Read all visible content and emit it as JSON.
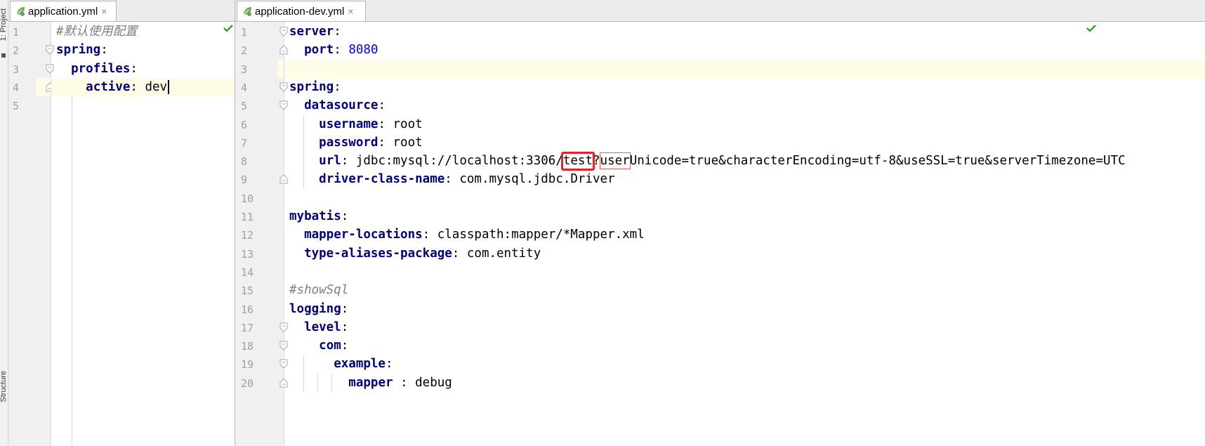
{
  "tool_window": {
    "project_label": "1: Project",
    "structure_label": "Structure"
  },
  "left_editor": {
    "tab": {
      "name": "application.yml",
      "close": "×"
    },
    "lines": [
      {
        "n": "1",
        "parts": [
          {
            "t": "#默认使用配置",
            "c": "c"
          }
        ]
      },
      {
        "n": "2",
        "parts": [
          {
            "t": "spring",
            "c": "k"
          },
          {
            "t": ":",
            "c": "p"
          }
        ]
      },
      {
        "n": "3",
        "parts": [
          {
            "t": "  ",
            "c": "p"
          },
          {
            "t": "profiles",
            "c": "k"
          },
          {
            "t": ":",
            "c": "p"
          }
        ]
      },
      {
        "n": "4",
        "parts": [
          {
            "t": "    ",
            "c": "p"
          },
          {
            "t": "active",
            "c": "k"
          },
          {
            "t": ": dev",
            "c": "p"
          }
        ]
      },
      {
        "n": "5",
        "parts": []
      }
    ]
  },
  "right_editor": {
    "tab": {
      "name": "application-dev.yml",
      "close": "×"
    },
    "lines": [
      {
        "n": "1",
        "parts": [
          {
            "t": "server",
            "c": "k"
          },
          {
            "t": ":",
            "c": "p"
          }
        ]
      },
      {
        "n": "2",
        "parts": [
          {
            "t": "  ",
            "c": "p"
          },
          {
            "t": "port",
            "c": "k"
          },
          {
            "t": ": ",
            "c": "p"
          },
          {
            "t": "8080",
            "c": "n"
          }
        ]
      },
      {
        "n": "3",
        "parts": []
      },
      {
        "n": "4",
        "parts": [
          {
            "t": "spring",
            "c": "k"
          },
          {
            "t": ":",
            "c": "p"
          }
        ]
      },
      {
        "n": "5",
        "parts": [
          {
            "t": "  ",
            "c": "p"
          },
          {
            "t": "datasource",
            "c": "k"
          },
          {
            "t": ":",
            "c": "p"
          }
        ]
      },
      {
        "n": "6",
        "parts": [
          {
            "t": "    ",
            "c": "p"
          },
          {
            "t": "username",
            "c": "k"
          },
          {
            "t": ": root",
            "c": "p"
          }
        ]
      },
      {
        "n": "7",
        "parts": [
          {
            "t": "    ",
            "c": "p"
          },
          {
            "t": "password",
            "c": "k"
          },
          {
            "t": ": root",
            "c": "p"
          }
        ]
      },
      {
        "n": "8",
        "parts": [
          {
            "t": "    ",
            "c": "p"
          },
          {
            "t": "url",
            "c": "k"
          },
          {
            "t": ": jdbc:mysql://localhost:3306/",
            "c": "p"
          },
          {
            "t": "test",
            "c": "p",
            "box": "thick"
          },
          {
            "t": "?",
            "c": "p"
          },
          {
            "t": "user",
            "c": "p",
            "box": "thin"
          },
          {
            "t": "Unicode=true&characterEncoding=utf-8&useSSL=true&serverTimezone=UTC",
            "c": "p"
          }
        ]
      },
      {
        "n": "9",
        "parts": [
          {
            "t": "    ",
            "c": "p"
          },
          {
            "t": "driver-class-name",
            "c": "k"
          },
          {
            "t": ": com.mysql.jdbc.Driver",
            "c": "p"
          }
        ]
      },
      {
        "n": "10",
        "parts": []
      },
      {
        "n": "11",
        "parts": [
          {
            "t": "mybatis",
            "c": "k"
          },
          {
            "t": ":",
            "c": "p"
          }
        ]
      },
      {
        "n": "12",
        "parts": [
          {
            "t": "  ",
            "c": "p"
          },
          {
            "t": "mapper-locations",
            "c": "k"
          },
          {
            "t": ": classpath:mapper/*Mapper.xml",
            "c": "p"
          }
        ]
      },
      {
        "n": "13",
        "parts": [
          {
            "t": "  ",
            "c": "p"
          },
          {
            "t": "type-aliases-package",
            "c": "k"
          },
          {
            "t": ": com.entity",
            "c": "p"
          }
        ]
      },
      {
        "n": "14",
        "parts": []
      },
      {
        "n": "15",
        "parts": [
          {
            "t": "#showSql",
            "c": "c"
          }
        ]
      },
      {
        "n": "16",
        "parts": [
          {
            "t": "logging",
            "c": "k"
          },
          {
            "t": ":",
            "c": "p"
          }
        ]
      },
      {
        "n": "17",
        "parts": [
          {
            "t": "  ",
            "c": "p"
          },
          {
            "t": "level",
            "c": "k"
          },
          {
            "t": ":",
            "c": "p"
          }
        ]
      },
      {
        "n": "18",
        "parts": [
          {
            "t": "    ",
            "c": "p"
          },
          {
            "t": "com",
            "c": "k"
          },
          {
            "t": ":",
            "c": "p"
          }
        ]
      },
      {
        "n": "19",
        "parts": [
          {
            "t": "      ",
            "c": "p"
          },
          {
            "t": "example",
            "c": "k"
          },
          {
            "t": ":",
            "c": "p"
          }
        ]
      },
      {
        "n": "20",
        "parts": [
          {
            "t": "        ",
            "c": "p"
          },
          {
            "t": "mapper",
            "c": "k"
          },
          {
            "t": " : debug",
            "c": "p"
          }
        ]
      }
    ]
  },
  "colors": {
    "keyword": "#000080",
    "number": "#0000ff",
    "comment": "#808080",
    "current_line": "#fefbe6",
    "highlight_box": "#e8202a",
    "ok_check": "#3c9a3c"
  }
}
